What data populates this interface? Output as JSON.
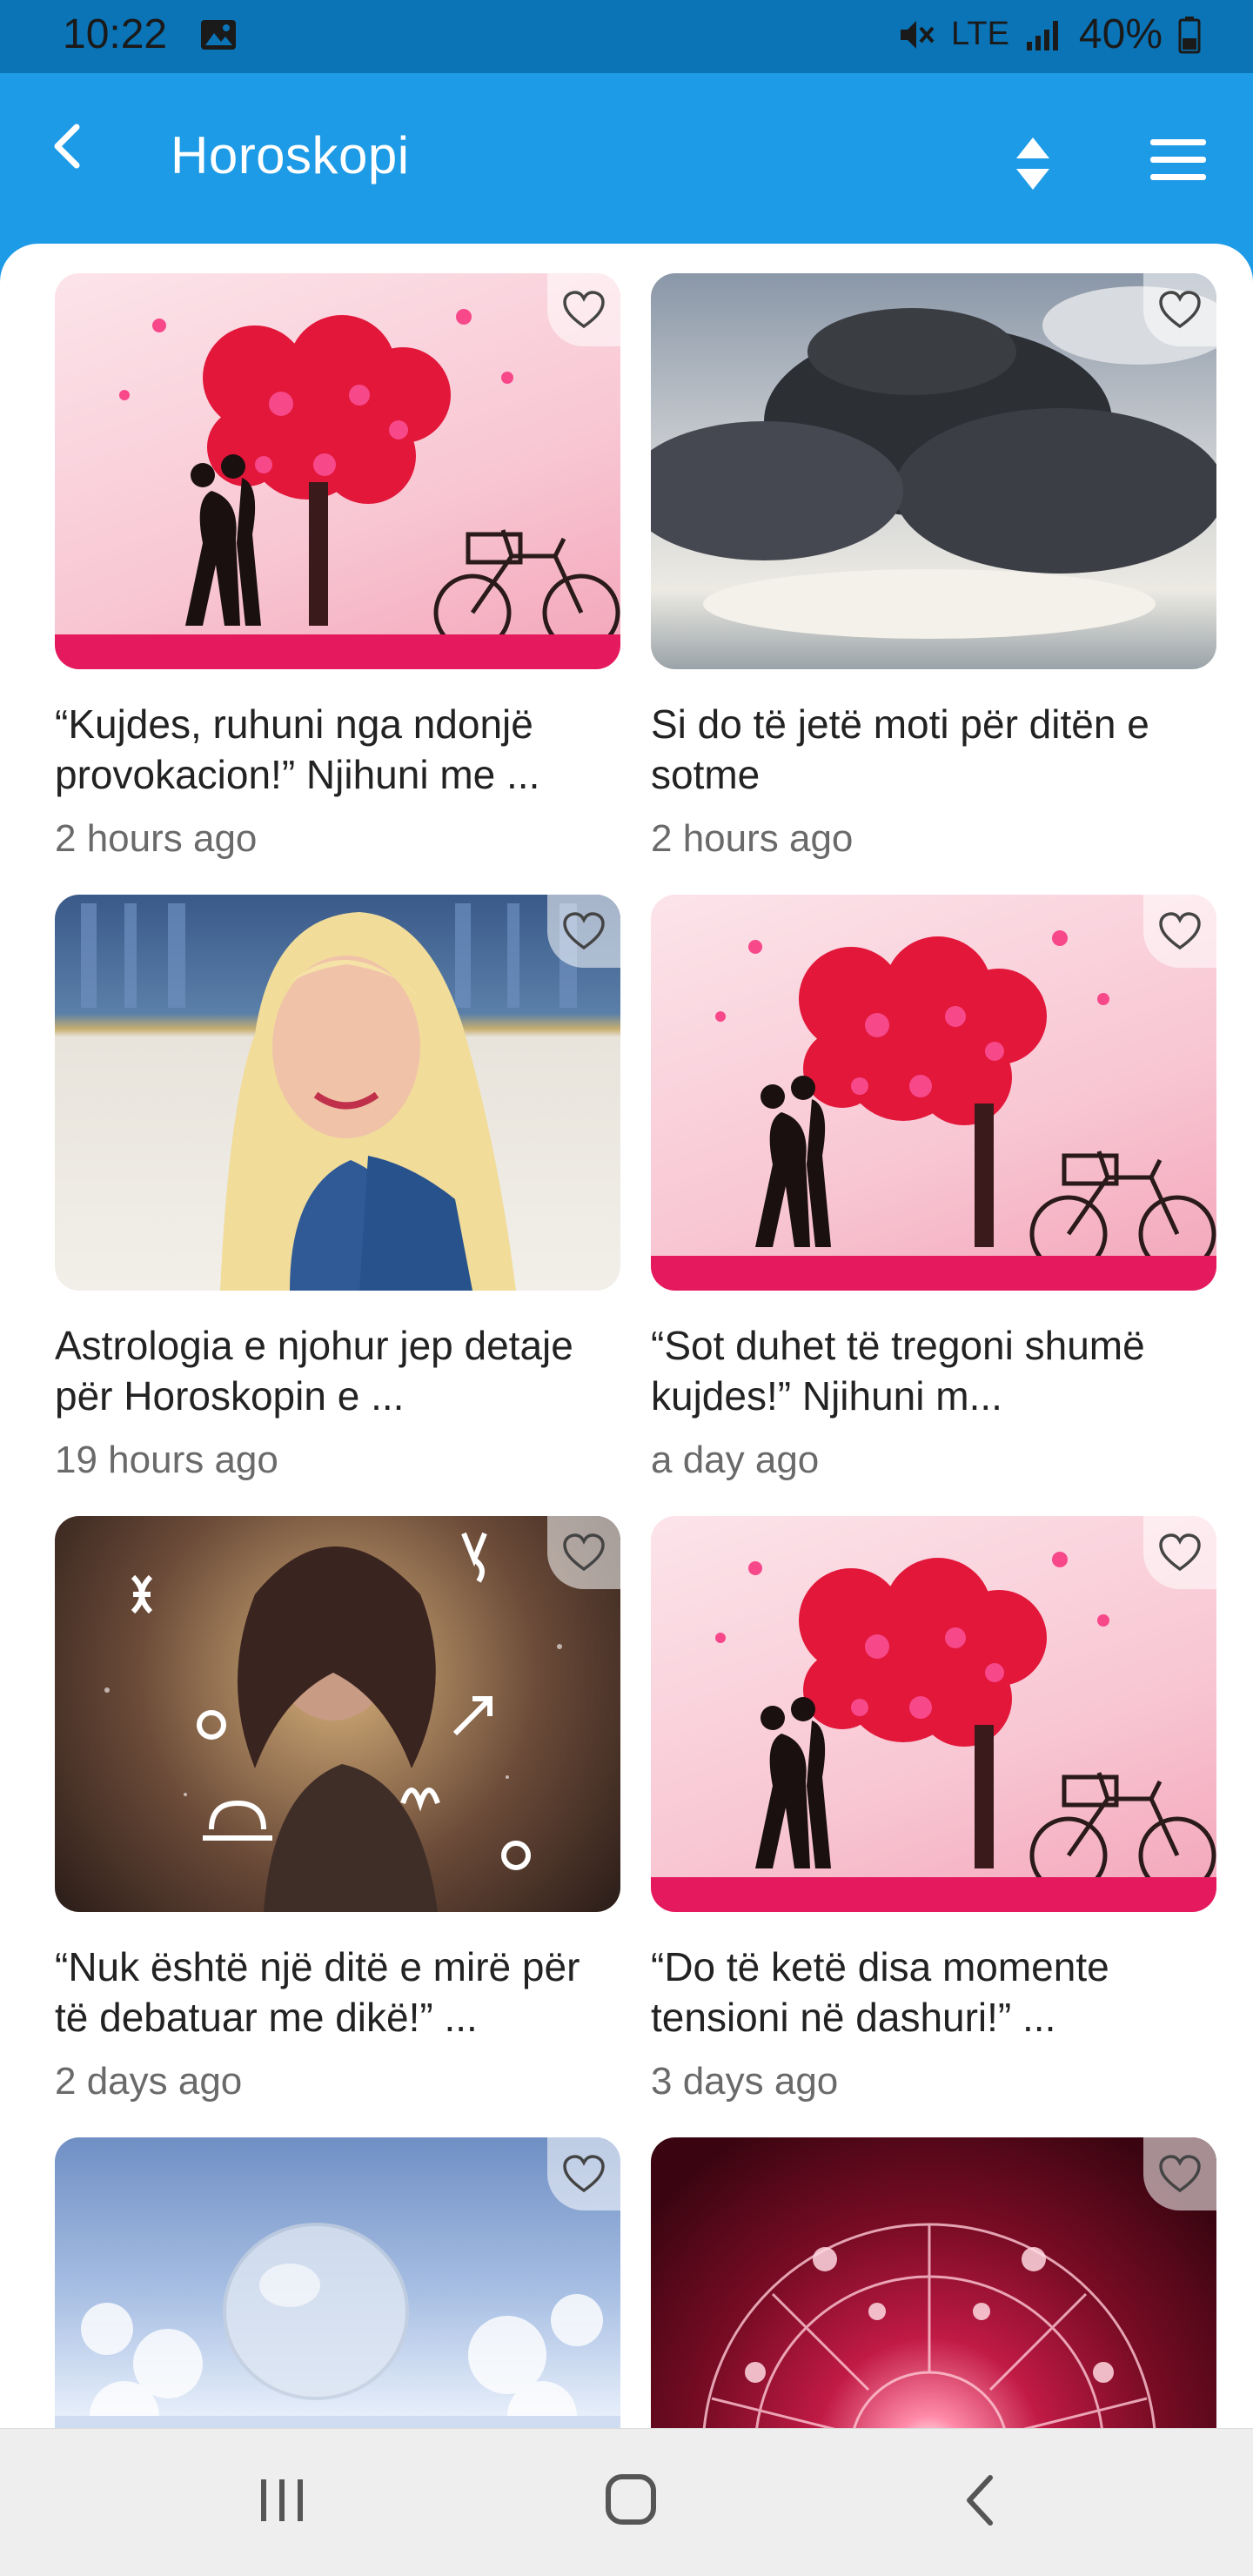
{
  "status_bar": {
    "time": "10:22",
    "network": "LTE",
    "battery": "40%",
    "icons": [
      "gallery-icon",
      "mute-icon",
      "signal-icon",
      "battery-icon"
    ]
  },
  "app_bar": {
    "title": "Horoskopi",
    "icons": [
      "back-arrow-icon",
      "sort-icon",
      "menu-icon"
    ],
    "color": "#1E9BE6"
  },
  "articles": [
    {
      "title": "“Kujdes, ruhuni nga ndonjë provokacion!” Njihuni me ...",
      "time": "2 hours ago",
      "image": "love-tree"
    },
    {
      "title": "Si do të jetë moti për ditën e sotme",
      "time": "2 hours ago",
      "image": "clouds"
    },
    {
      "title": "Astrologia e njohur jep detaje për Horoskopin e ...",
      "time": "19 hours ago",
      "image": "portrait"
    },
    {
      "title": "“Sot duhet të tregoni shumë kujdes!” Njihuni m...",
      "time": "a day ago",
      "image": "love-tree"
    },
    {
      "title": "“Nuk është një ditë e mirë për të debatuar me dikë!” ...",
      "time": "2 days ago",
      "image": "zodiac-woman"
    },
    {
      "title": "“Do të ketë disa momente tensioni në dashuri!” ...",
      "time": "3 days ago",
      "image": "love-tree"
    },
    {
      "title": "",
      "time": "",
      "image": "frost"
    },
    {
      "title": "",
      "time": "",
      "image": "zodiac-wheel"
    }
  ],
  "nav_bar": {
    "icons": [
      "recents-icon",
      "home-icon",
      "back-icon"
    ]
  }
}
